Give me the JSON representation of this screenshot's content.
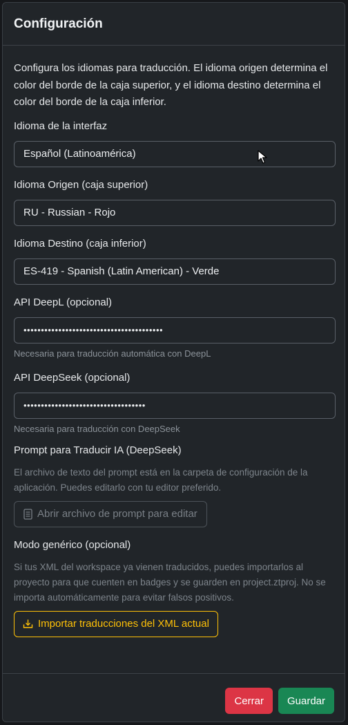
{
  "modal": {
    "title": "Configuración",
    "intro": "Configura los idiomas para traducción. El idioma origen determina el color del borde de la caja superior, y el idioma destino determina el color del borde de la caja inferior."
  },
  "fields": {
    "ui_language": {
      "label": "Idioma de la interfaz",
      "value": "Español (Latinoamérica)"
    },
    "source_language": {
      "label": "Idioma Origen (caja superior)",
      "value": "RU - Russian - Rojo"
    },
    "target_language": {
      "label": "Idioma Destino (caja inferior)",
      "value": "ES-419 - Spanish (Latin American) - Verde"
    },
    "deepl_api": {
      "label": "API DeepL (opcional)",
      "value": "••••••••••••••••••••••••••••••••••••••••",
      "help": "Necesaria para traducción automática con DeepL"
    },
    "deepseek_api": {
      "label": "API DeepSeek (opcional)",
      "value": "•••••••••••••••••••••••••••••••••••",
      "help": "Necesaria para traducción con DeepSeek"
    }
  },
  "prompt": {
    "label": "Prompt para Traducir IA (DeepSeek)",
    "help": "El archivo de texto del prompt está en la carpeta de configuración de la aplicación. Puedes editarlo con tu editor preferido.",
    "button_label": "Abrir archivo de prompt para editar",
    "button_icon": "file-text-icon"
  },
  "generic_mode": {
    "label": "Modo genérico (opcional)",
    "help": "Si tus XML del workspace ya vienen traducidos, puedes importarlos al proyecto para que cuenten en badges y se guarden en project.ztproj. No se importa automáticamente para evitar falsos positivos.",
    "button_label": "Importar traducciones del XML actual",
    "button_icon": "download-tray-icon"
  },
  "footer": {
    "close_label": "Cerrar",
    "save_label": "Guardar"
  },
  "colors": {
    "danger": "#dc3545",
    "success": "#198754",
    "warning": "#ffc107",
    "background": "#212529"
  }
}
